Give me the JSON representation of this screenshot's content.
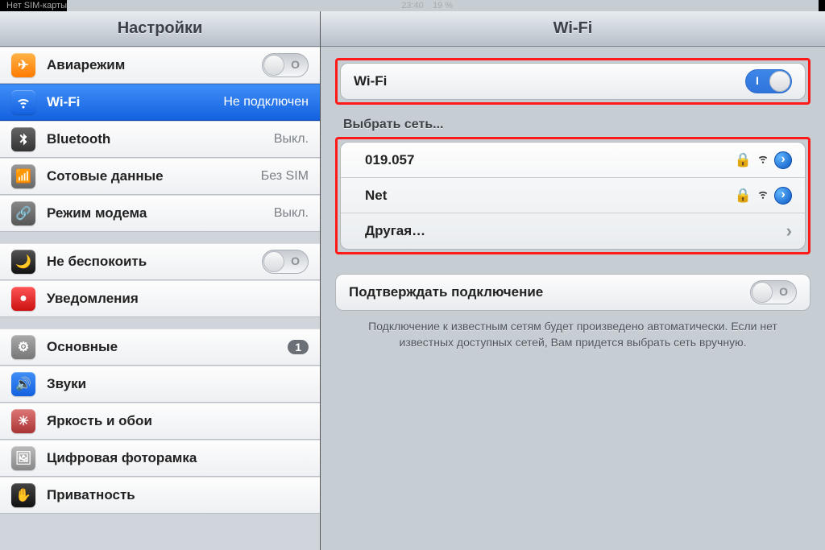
{
  "status": {
    "left": "Нет SIM-карты",
    "time": "23:40",
    "battery": "19 %"
  },
  "left_header": "Настройки",
  "right_header": "Wi-Fi",
  "sidebar": {
    "airplane": "Авиарежим",
    "wifi": "Wi-Fi",
    "wifi_status": "Не подключен",
    "bluetooth": "Bluetooth",
    "bluetooth_status": "Выкл.",
    "cellular": "Сотовые данные",
    "cellular_status": "Без SIM",
    "hotspot": "Режим модема",
    "hotspot_status": "Выкл.",
    "dnd": "Не беспокоить",
    "notifications": "Уведомления",
    "general": "Основные",
    "general_badge": "1",
    "sounds": "Звуки",
    "brightness": "Яркость и обои",
    "frame": "Цифровая фоторамка",
    "privacy": "Приватность"
  },
  "detail": {
    "wifi_row": "Wi-Fi",
    "choose_network": "Выбрать сеть...",
    "networks": [
      {
        "name": "019.057",
        "locked": true
      },
      {
        "name": "Net",
        "locked": true
      }
    ],
    "other": "Другая…",
    "ask_join": "Подтверждать подключение",
    "footnote": "Подключение к известным сетям будет произведено автоматически. Если нет известных доступных сетей, Вам придется выбрать сеть вручную."
  }
}
